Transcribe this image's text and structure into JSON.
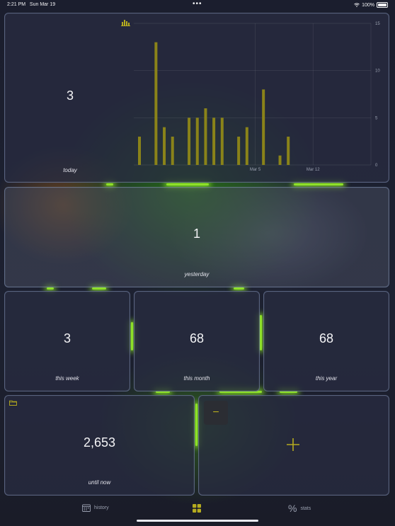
{
  "status_bar": {
    "time": "2:21 PM",
    "date": "Sun Mar 19",
    "battery": "100%"
  },
  "stats": {
    "today": {
      "value": "3",
      "label": "today"
    },
    "yesterday": {
      "value": "1",
      "label": "yesterday"
    },
    "this_week": {
      "value": "3",
      "label": "this week"
    },
    "this_month": {
      "value": "68",
      "label": "this month"
    },
    "this_year": {
      "value": "68",
      "label": "this year"
    },
    "until_now": {
      "value": "2,653",
      "label": "until now"
    }
  },
  "controls": {
    "decrement_symbol": "−"
  },
  "tabs": [
    {
      "label": "history",
      "icon": "calendar-icon"
    },
    {
      "label": "",
      "icon": "grid-icon"
    },
    {
      "label": "stats",
      "icon": "percent-icon"
    }
  ],
  "colors": {
    "accent": "#b5ab1f",
    "bar": "#8a8319",
    "card_border": "#96aad2"
  },
  "chart_data": {
    "type": "bar",
    "x_start": "2023-02-19",
    "x_end": "2023-03-19",
    "x_ticks": [
      "Mar 5",
      "Mar 12"
    ],
    "ylim": [
      0,
      15
    ],
    "y_ticks": [
      0,
      5,
      10,
      15
    ],
    "grid": true,
    "points": [
      {
        "x": "2023-02-19",
        "y": 3
      },
      {
        "x": "2023-02-21",
        "y": 13
      },
      {
        "x": "2023-02-22",
        "y": 4
      },
      {
        "x": "2023-02-23",
        "y": 3
      },
      {
        "x": "2023-02-25",
        "y": 5
      },
      {
        "x": "2023-02-26",
        "y": 5
      },
      {
        "x": "2023-02-27",
        "y": 6
      },
      {
        "x": "2023-02-28",
        "y": 5
      },
      {
        "x": "2023-03-01",
        "y": 5
      },
      {
        "x": "2023-03-03",
        "y": 3
      },
      {
        "x": "2023-03-04",
        "y": 4
      },
      {
        "x": "2023-03-06",
        "y": 8
      },
      {
        "x": "2023-03-08",
        "y": 1
      },
      {
        "x": "2023-03-09",
        "y": 3
      }
    ]
  }
}
